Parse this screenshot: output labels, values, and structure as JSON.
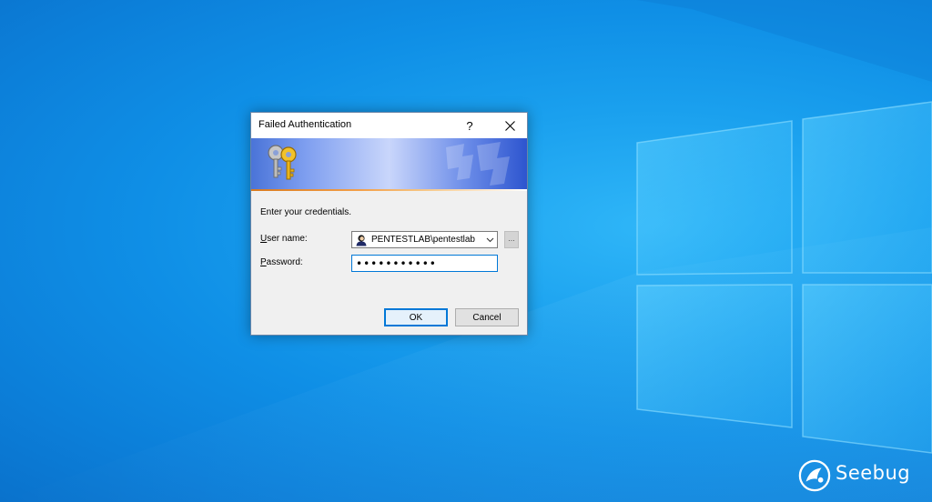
{
  "desktop": {
    "background": "windows-logo-wallpaper",
    "accent": "#1aa0ee"
  },
  "dialog": {
    "title": "Failed Authentication",
    "help_label": "?",
    "close_icon": "close-icon",
    "banner_icon": "keys-icon",
    "prompt": "Enter your credentials.",
    "username_label_accel": "U",
    "username_label_rest": "ser name:",
    "username_value": "PENTESTLAB\\pentestlab",
    "browse_label": "...",
    "password_label_accel": "P",
    "password_label_rest": "assword:",
    "password_value": "•••••••••••",
    "ok_label": "OK",
    "cancel_label": "Cancel"
  },
  "watermark": {
    "text": "Seebug",
    "icon": "seebug-icon"
  }
}
